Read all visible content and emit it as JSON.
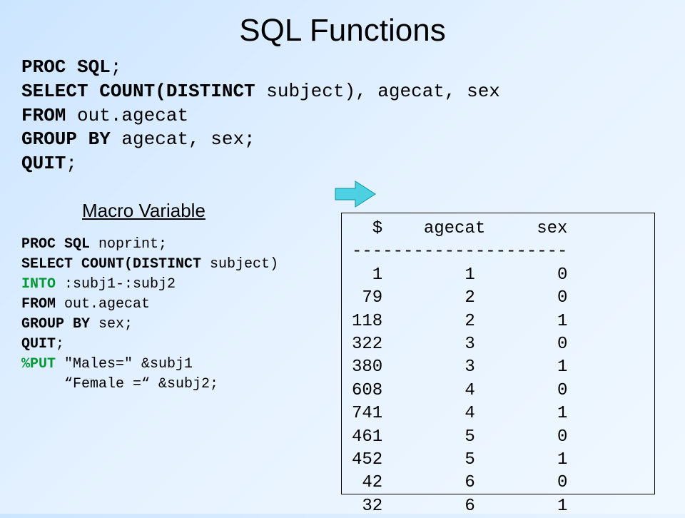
{
  "title": "SQL Functions",
  "code1": {
    "l1_kw": "PROC SQL",
    "l1_rest": ";",
    "l2_kw": "SELECT COUNT(DISTINCT",
    "l2_rest": " subject), agecat, sex",
    "l3_kw": "FROM",
    "l3_rest": " out.agecat",
    "l4_kw": "GROUP BY",
    "l4_rest": " agecat, sex;",
    "l5_kw": "QUIT",
    "l5_rest": ";"
  },
  "macro_heading": "Macro Variable",
  "code2": {
    "l1_kw": "PROC SQL",
    "l1_rest": " noprint;",
    "l2_kw": "SELECT COUNT(DISTINCT",
    "l2_rest": " subject)",
    "l3_kw": "INTO",
    "l3_rest": " :subj1-:subj2",
    "l4_kw": "FROM",
    "l4_rest": " out.agecat",
    "l5_kw": "GROUP BY",
    "l5_rest": " sex;",
    "l6_kw": "QUIT",
    "l6_rest": ";",
    "l7_kw": "%PUT",
    "l7_rest": " \"Males=\" &subj1",
    "l8": "     “Female =“ &subj2;"
  },
  "output": {
    "header": "  $    agecat     sex",
    "divider": "---------------------",
    "rows": [
      "  1        1        0",
      " 79        2        0",
      "118        2        1",
      "322        3        0",
      "380        3        1",
      "608        4        0",
      "741        4        1",
      "461        5        0",
      "452        5        1",
      " 42        6        0",
      " 32        6        1"
    ]
  },
  "chart_data": {
    "type": "table",
    "title": "SQL output: count distinct subject by agecat and sex",
    "columns": [
      "$",
      "agecat",
      "sex"
    ],
    "rows": [
      [
        1,
        1,
        0
      ],
      [
        79,
        2,
        0
      ],
      [
        118,
        2,
        1
      ],
      [
        322,
        3,
        0
      ],
      [
        380,
        3,
        1
      ],
      [
        608,
        4,
        0
      ],
      [
        741,
        4,
        1
      ],
      [
        461,
        5,
        0
      ],
      [
        452,
        5,
        1
      ],
      [
        42,
        6,
        0
      ],
      [
        32,
        6,
        1
      ]
    ]
  }
}
